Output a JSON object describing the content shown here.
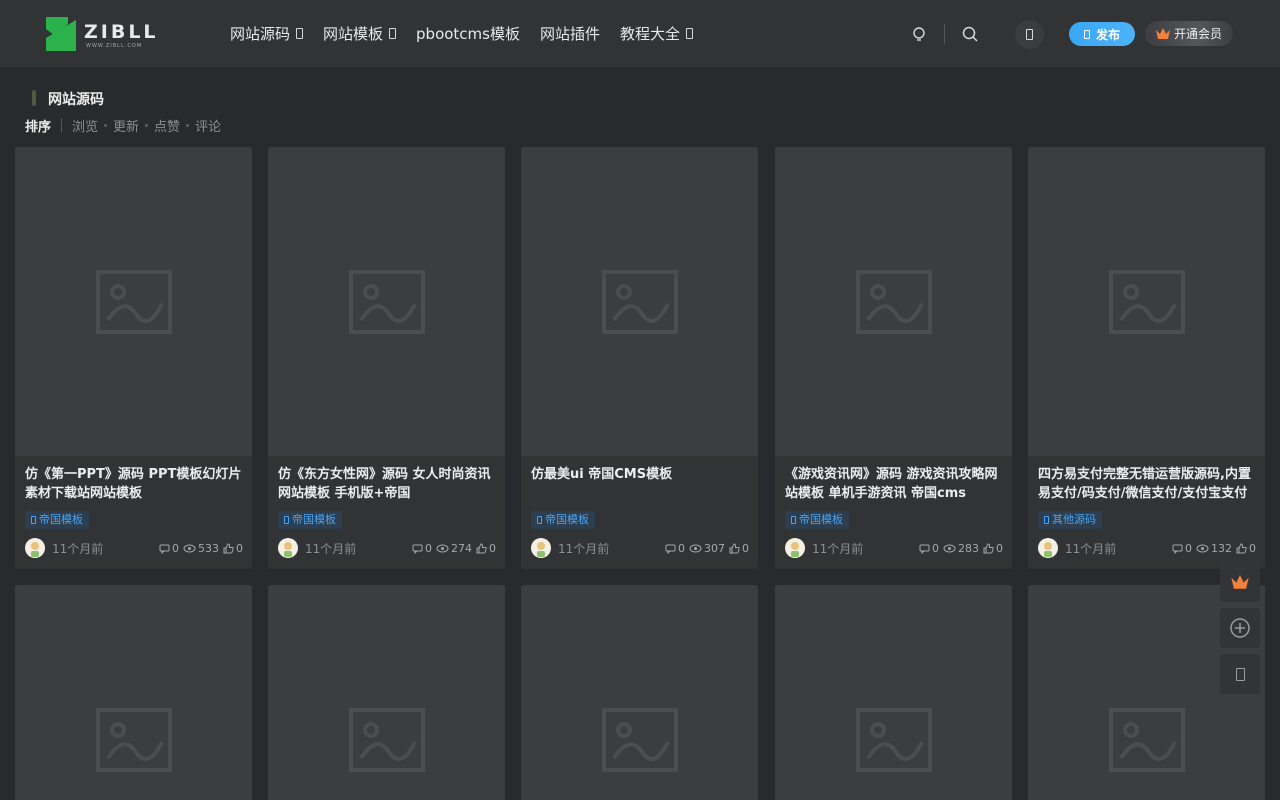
{
  "header": {
    "logo_text": "ZIBLL",
    "logo_sub": "WWW.ZIBLL.COM",
    "nav": [
      {
        "label": "网站源码",
        "has_dropdown": true
      },
      {
        "label": "网站模板",
        "has_dropdown": true
      },
      {
        "label": "pbootcms模板",
        "has_dropdown": false
      },
      {
        "label": "网站插件",
        "has_dropdown": false
      },
      {
        "label": "教程大全",
        "has_dropdown": true
      }
    ],
    "publish_label": "发布",
    "vip_label": "开通会员",
    "icons": [
      "theme-icon",
      "search-icon",
      "user-icon",
      "crown-icon"
    ]
  },
  "section": {
    "title": "网站源码",
    "sort_label": "排序",
    "sort_options": [
      "浏览",
      "更新",
      "点赞",
      "评论"
    ]
  },
  "cards": [
    {
      "title": "仿《第一PPT》源码 PPT模板幻灯片素材下载站网站模板",
      "tag": "帝国模板",
      "time": "11个月前",
      "comments": "0",
      "views": "533",
      "likes": "0"
    },
    {
      "title": "仿《东方女性网》源码 女人时尚资讯网站模板 手机版+帝国",
      "tag": "帝国模板",
      "time": "11个月前",
      "comments": "0",
      "views": "274",
      "likes": "0"
    },
    {
      "title": "仿最美ui 帝国CMS模板",
      "tag": "帝国模板",
      "time": "11个月前",
      "comments": "0",
      "views": "307",
      "likes": "0"
    },
    {
      "title": "《游戏资讯网》源码 游戏资讯攻略网站模板 单机手游资讯 帝国cms",
      "tag": "帝国模板",
      "time": "11个月前",
      "comments": "0",
      "views": "283",
      "likes": "0"
    },
    {
      "title": "四方易支付完整无错运营版源码,内置易支付/码支付/微信支付/支付宝支付",
      "tag": "其他源码",
      "time": "11个月前",
      "comments": "0",
      "views": "132",
      "likes": "0"
    }
  ],
  "colors": {
    "background": "#292a2d",
    "header": "#323335",
    "accent_blue": "#3aa6f6",
    "tag_text": "#4aa3ef",
    "logo_green": "#2bb24c",
    "crown_orange": "#f2823a"
  },
  "floating_toolbar": [
    "crown-icon",
    "add-circle-icon",
    "tofu-icon"
  ]
}
